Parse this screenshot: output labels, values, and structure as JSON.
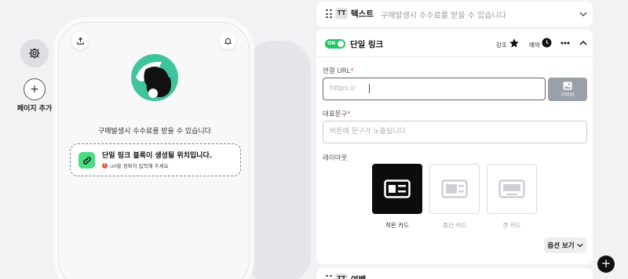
{
  "sidebar": {
    "settings_icon": "gear-icon",
    "add_icon": "plus-icon",
    "add_page_label": "페이지 추가"
  },
  "phone": {
    "share_icon": "share-icon",
    "bell_icon": "bell-icon",
    "profile_text": "구매발생시 수수료를 받을 수 있습니다",
    "link_block": {
      "title": "단일 링크 블록이 생성될 위치입니다.",
      "warning": "url을 정확히 입력해 주세요"
    }
  },
  "editor": {
    "text_block": {
      "type_icon": "TT",
      "title": "텍스트",
      "preview": "구매발생시 수수료를 받을 수 있습니다"
    },
    "link_block": {
      "toggle_label": "ON",
      "title": "단일 링크",
      "highlight_label": "강조",
      "schedule_label": "예약",
      "url_label": "연결 URL",
      "url_placeholder": "https://",
      "image_button_label": "이미지",
      "caption_label": "대표문구",
      "caption_placeholder": "버튼에 문구가 노출됩니다",
      "layout_label": "레이아웃",
      "layouts": [
        {
          "label": "작은 카드",
          "selected": true
        },
        {
          "label": "중간 카드",
          "selected": false
        },
        {
          "label": "큰 카드",
          "selected": false
        }
      ],
      "options_label": "옵션 보기"
    },
    "bottom_block": {
      "type_icon": "TT",
      "title": "여백"
    }
  },
  "colors": {
    "accent_green": "#22c55e",
    "warning_red": "#e5533d",
    "selected_dark": "#0c0c0c"
  }
}
